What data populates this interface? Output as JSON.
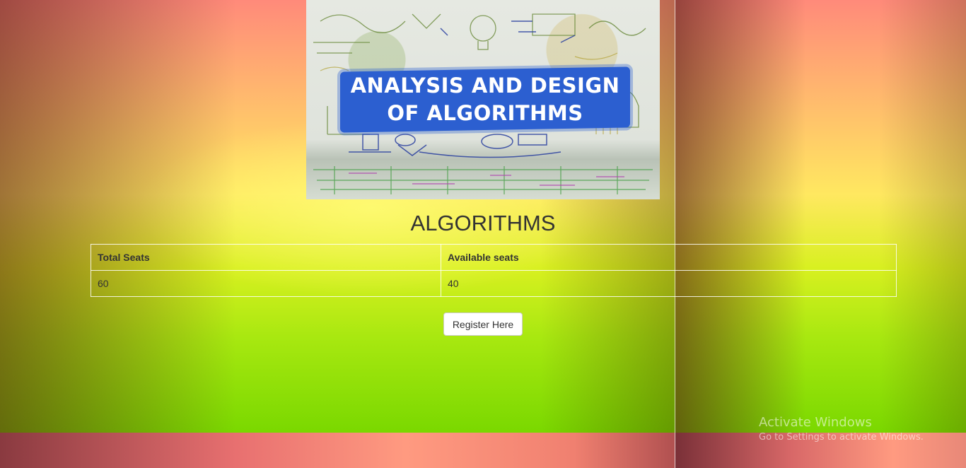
{
  "banner": {
    "line1": "ANALYSIS AND DESIGN",
    "line2": "OF ALGORITHMS"
  },
  "page": {
    "heading": "ALGORITHMS"
  },
  "table": {
    "headers": [
      "Total Seats",
      "Available seats"
    ],
    "rows": [
      [
        "60",
        "40"
      ]
    ]
  },
  "actions": {
    "register_label": "Register Here"
  },
  "watermark": {
    "title": "Activate Windows",
    "subtitle": "Go to Settings to activate Windows."
  },
  "colors": {
    "banner_strip": "#2c5fd0",
    "text": "#333333",
    "gradient_top": "#ff8a7a",
    "gradient_middle": "#ffe860",
    "gradient_bottom": "#7ad800"
  }
}
